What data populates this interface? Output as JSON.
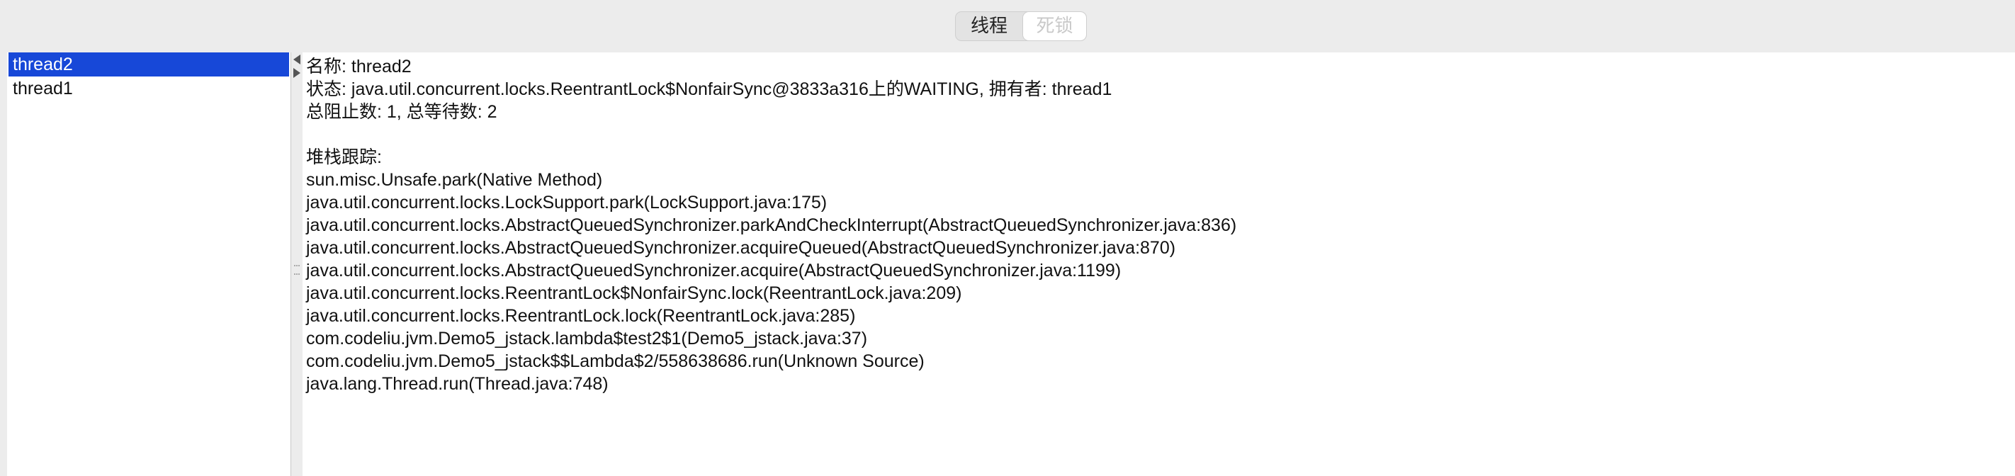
{
  "tabs": [
    {
      "label": "线程",
      "selected": true
    },
    {
      "label": "死锁",
      "selected": false
    }
  ],
  "threads": [
    {
      "name": "thread2",
      "selected": true
    },
    {
      "name": "thread1",
      "selected": false
    }
  ],
  "detail": {
    "name_line": "名称: thread2",
    "state_line": "状态: java.util.concurrent.locks.ReentrantLock$NonfairSync@3833a316上的WAITING, 拥有者: thread1",
    "counts_line": "总阻止数: 1, 总等待数: 2",
    "stack_header": "堆栈跟踪:",
    "stack": [
      "sun.misc.Unsafe.park(Native Method)",
      "java.util.concurrent.locks.LockSupport.park(LockSupport.java:175)",
      "java.util.concurrent.locks.AbstractQueuedSynchronizer.parkAndCheckInterrupt(AbstractQueuedSynchronizer.java:836)",
      "java.util.concurrent.locks.AbstractQueuedSynchronizer.acquireQueued(AbstractQueuedSynchronizer.java:870)",
      "java.util.concurrent.locks.AbstractQueuedSynchronizer.acquire(AbstractQueuedSynchronizer.java:1199)",
      "java.util.concurrent.locks.ReentrantLock$NonfairSync.lock(ReentrantLock.java:209)",
      "java.util.concurrent.locks.ReentrantLock.lock(ReentrantLock.java:285)",
      "com.codeliu.jvm.Demo5_jstack.lambda$test2$1(Demo5_jstack.java:37)",
      "com.codeliu.jvm.Demo5_jstack$$Lambda$2/558638686.run(Unknown Source)",
      "java.lang.Thread.run(Thread.java:748)"
    ]
  },
  "colors": {
    "selection": "#1748d8",
    "window_bg": "#ececec",
    "panel_bg": "#ffffff"
  }
}
